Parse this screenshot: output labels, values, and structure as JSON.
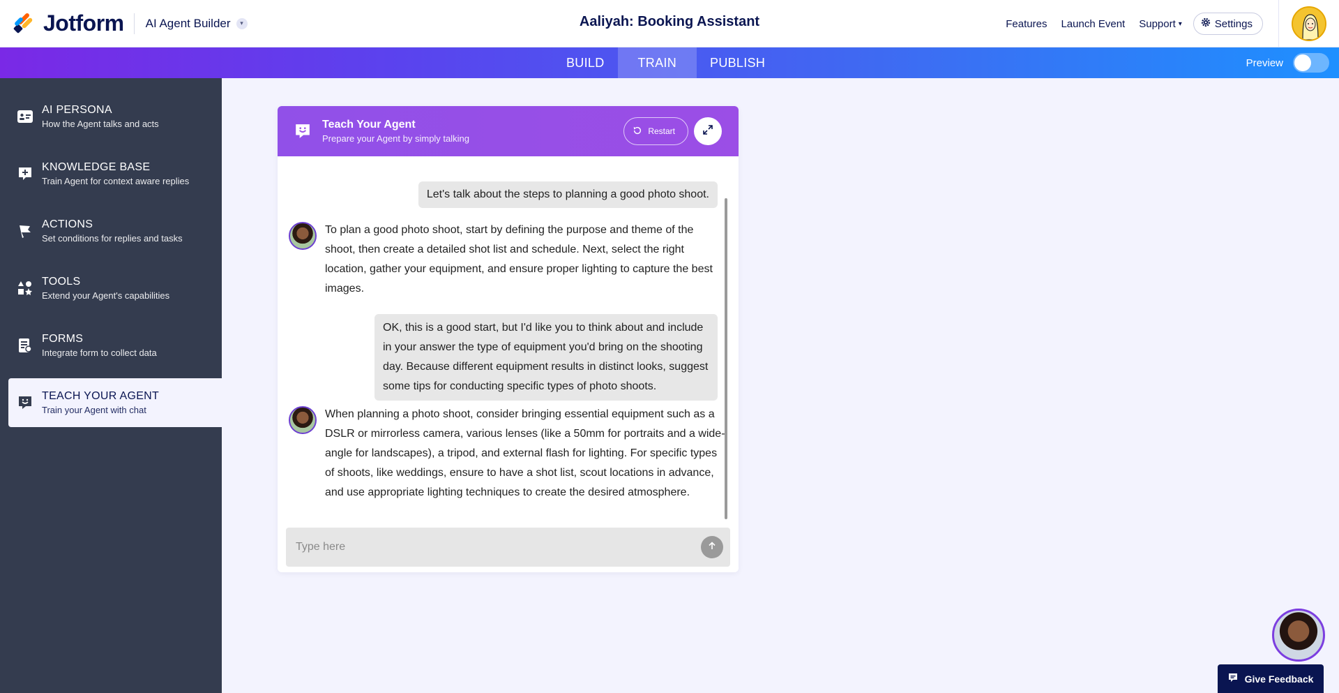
{
  "header": {
    "logo_text": "Jotform",
    "builder_name": "AI Agent Builder",
    "page_title": "Aaliyah: Booking Assistant",
    "nav": {
      "features": "Features",
      "launch_event": "Launch Event",
      "support": "Support",
      "settings": "Settings"
    }
  },
  "tabs": [
    {
      "label": "BUILD",
      "active": false
    },
    {
      "label": "TRAIN",
      "active": true
    },
    {
      "label": "PUBLISH",
      "active": false
    }
  ],
  "preview_label": "Preview",
  "sidebar": {
    "items": [
      {
        "title": "AI PERSONA",
        "subtitle": "How the Agent talks and acts",
        "icon": "id-card-icon"
      },
      {
        "title": "KNOWLEDGE BASE",
        "subtitle": "Train Agent for context aware replies",
        "icon": "knowledge-add-icon"
      },
      {
        "title": "ACTIONS",
        "subtitle": "Set conditions for replies and tasks",
        "icon": "flag-icon"
      },
      {
        "title": "TOOLS",
        "subtitle": "Extend your Agent's capabilities",
        "icon": "shapes-icon"
      },
      {
        "title": "FORMS",
        "subtitle": "Integrate form to collect data",
        "icon": "form-icon"
      },
      {
        "title": "TEACH YOUR AGENT",
        "subtitle": "Train your Agent with chat",
        "icon": "chat-smile-icon",
        "active": true
      }
    ]
  },
  "panel": {
    "title": "Teach Your Agent",
    "subtitle": "Prepare your Agent by simply talking",
    "restart_label": "Restart",
    "messages": [
      {
        "role": "user",
        "text": "Let's talk about the steps to planning a good photo shoot."
      },
      {
        "role": "bot",
        "text": "To plan a good photo shoot, start by defining the purpose and theme of the shoot, then create a detailed shot list and schedule. Next, select the right location, gather your equipment, and ensure proper lighting to capture the best images."
      },
      {
        "role": "user",
        "text": "OK, this is a good start, but I'd like you to think about and include in your answer the type of equipment you'd bring on the shooting day. Because different equipment results in distinct looks, suggest some tips for conducting specific types of photo shoots."
      },
      {
        "role": "bot",
        "text": "When planning a photo shoot, consider bringing essential equipment such as a DSLR or mirrorless camera, various lenses (like a 50mm for portraits and a wide-angle for landscapes), a tripod, and external flash for lighting. For specific types of shoots, like weddings, ensure to have a shot list, scout locations in advance, and use appropriate lighting techniques to create the desired atmosphere."
      }
    ],
    "input_placeholder": "Type here"
  },
  "feedback_label": "Give Feedback",
  "colors": {
    "navy": "#0a1551",
    "sidebar_bg": "#343c4f",
    "panel_header": "#9b4ee6",
    "page_bg": "#f3f3fe"
  }
}
